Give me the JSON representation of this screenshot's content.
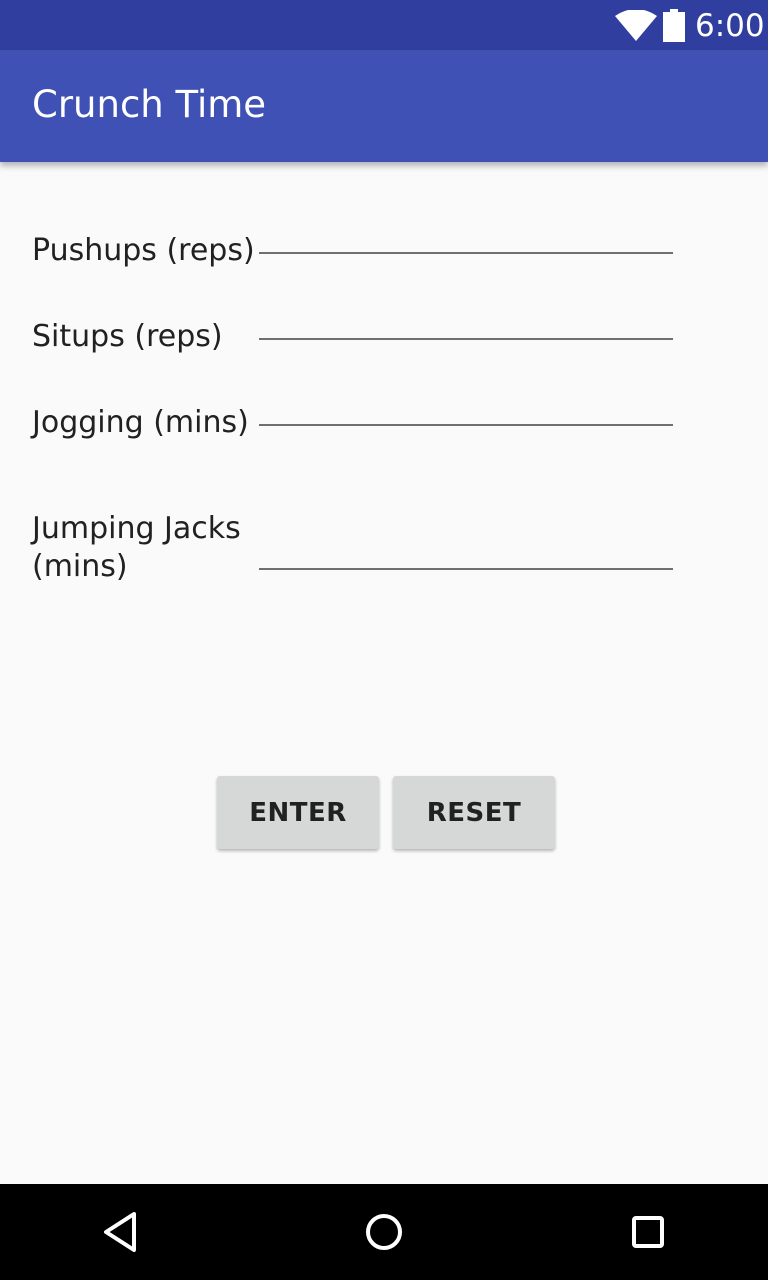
{
  "status_bar": {
    "time": "6:00",
    "icons": [
      "wifi-icon",
      "battery-icon"
    ]
  },
  "app_bar": {
    "title": "Crunch Time"
  },
  "form": {
    "fields": [
      {
        "label": "Pushups (reps)",
        "value": ""
      },
      {
        "label": "Situps (reps)",
        "value": ""
      },
      {
        "label": "Jogging (mins)",
        "value": ""
      },
      {
        "label": "Jumping Jacks\n(mins)",
        "value": ""
      }
    ]
  },
  "buttons": {
    "enter": "ENTER",
    "reset": "RESET"
  },
  "nav_bar": {
    "icons": [
      "back-icon",
      "home-icon",
      "recents-icon"
    ]
  },
  "colors": {
    "status_bar": "#303f9f",
    "app_bar": "#3f51b5",
    "background": "#fafafa",
    "button": "#d6d7d7"
  }
}
